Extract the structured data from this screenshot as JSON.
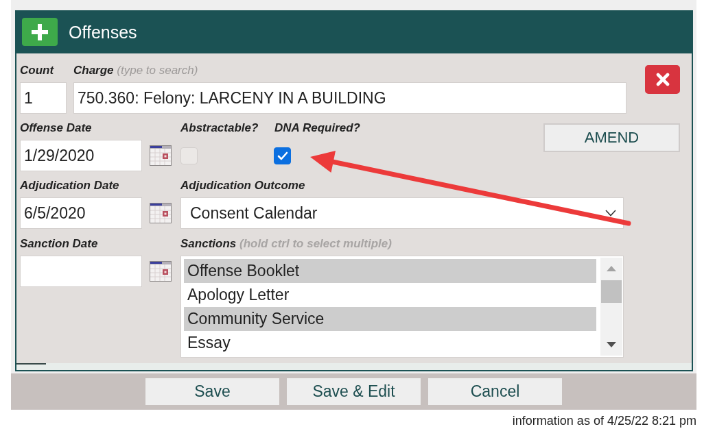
{
  "panel": {
    "title": "Offenses"
  },
  "count": {
    "label": "Count",
    "value": "1"
  },
  "charge": {
    "label": "Charge",
    "hint": "(type to search)",
    "value": "750.360: Felony: LARCENY IN A BUILDING"
  },
  "date_fields": [
    {
      "label": "Offense Date",
      "value": "1/29/2020"
    },
    {
      "label": "Adjudication Date",
      "value": "6/5/2020"
    },
    {
      "label": "Sanction Date"
    }
  ],
  "checkboxes": [
    {
      "label": "Abstractable?",
      "checked": false,
      "disabled": true
    },
    {
      "label": "DNA Required?",
      "checked": true,
      "disabled": false
    }
  ],
  "amend_button": {
    "label": "AMEND"
  },
  "adjudication_outcome": {
    "label": "Adjudication Outcome",
    "value": "Consent Calendar"
  },
  "sanctions": {
    "label": "Sanctions",
    "hint": "(hold ctrl to select multiple)",
    "options": [
      {
        "label": "Offense Booklet",
        "selected": true
      },
      {
        "label": "Apology Letter",
        "selected": false
      },
      {
        "label": "Community Service",
        "selected": true
      },
      {
        "label": "Essay",
        "selected": false
      }
    ]
  },
  "buttons": [
    {
      "label": "Save"
    },
    {
      "label": "Save & Edit"
    },
    {
      "label": "Cancel"
    }
  ],
  "footer_note": "information as of 4/25/22 8:21 pm"
}
